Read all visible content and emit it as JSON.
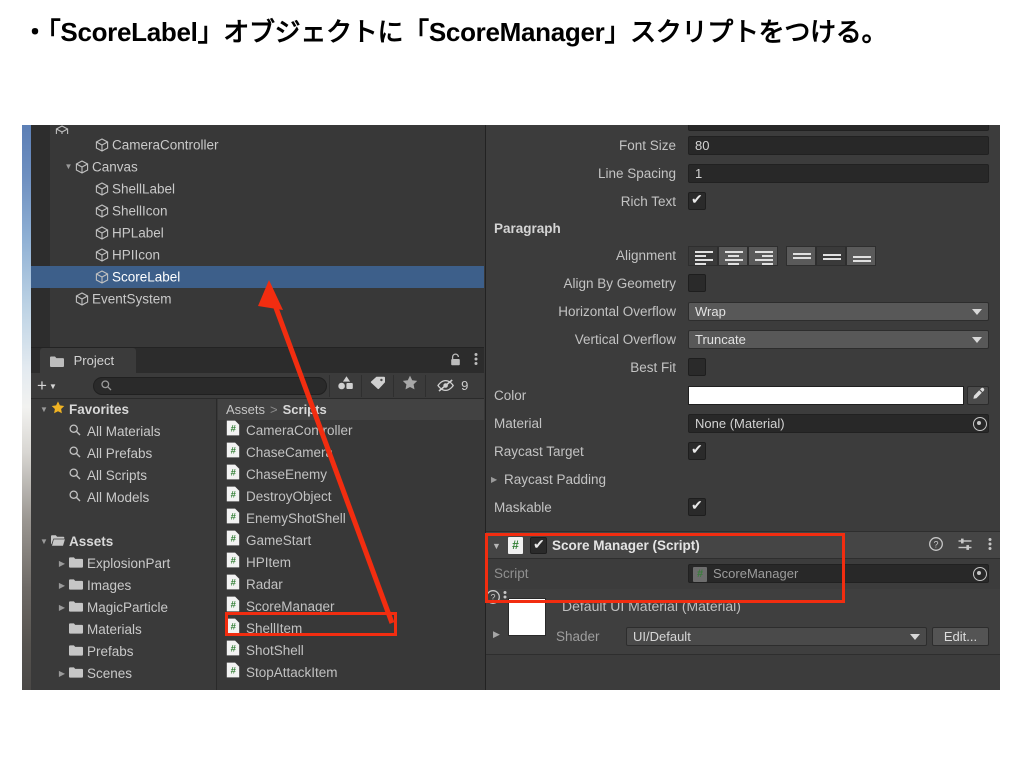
{
  "slide": {
    "heading": "・「ScoreLabel」オブジェクトに「ScoreManager」スクリプトをつける。"
  },
  "accent_color": "#f22d10",
  "selection_color": "#3d5f8a",
  "hierarchy": {
    "rows": [
      {
        "label": "",
        "indent": 0,
        "twisty": "",
        "icon": "cube-icon",
        "selected": false,
        "clipped": true
      },
      {
        "label": "CameraController",
        "indent": 2,
        "twisty": "",
        "icon": "cube-icon",
        "selected": false
      },
      {
        "label": "Canvas",
        "indent": 1,
        "twisty": "▼",
        "icon": "cube-icon",
        "selected": false
      },
      {
        "label": "ShellLabel",
        "indent": 2,
        "twisty": "",
        "icon": "cube-icon",
        "selected": false
      },
      {
        "label": "ShellIcon",
        "indent": 2,
        "twisty": "",
        "icon": "cube-icon",
        "selected": false
      },
      {
        "label": "HPLabel",
        "indent": 2,
        "twisty": "",
        "icon": "cube-icon",
        "selected": false
      },
      {
        "label": "HPIIcon",
        "indent": 2,
        "twisty": "",
        "icon": "cube-icon",
        "selected": false
      },
      {
        "label": "ScoreLabel",
        "indent": 2,
        "twisty": "",
        "icon": "cube-icon",
        "selected": true
      },
      {
        "label": "EventSystem",
        "indent": 1,
        "twisty": "",
        "icon": "cube-icon",
        "selected": false
      }
    ]
  },
  "project": {
    "tab_label": "Project",
    "tab_icon": "folder-icon",
    "lock_icon": "lock-icon",
    "menu_icon": "kebab-menu-icon",
    "add_label": "+",
    "search_placeholder": "",
    "search_value": "",
    "toolbar_icons": [
      {
        "name": "asset-type-filter-icon",
        "label": ""
      },
      {
        "name": "label-filter-icon",
        "label": ""
      },
      {
        "name": "favorite-star-icon",
        "label": ""
      },
      {
        "name": "hidden-packages-icon",
        "label": "9"
      }
    ],
    "tree": [
      {
        "label": "Favorites",
        "indent": 0,
        "twisty": "▼",
        "icon": "star-icon",
        "bold": true
      },
      {
        "label": "All Materials",
        "indent": 1,
        "twisty": "",
        "icon": "search-icon",
        "bold": false
      },
      {
        "label": "All Prefabs",
        "indent": 1,
        "twisty": "",
        "icon": "search-icon",
        "bold": false
      },
      {
        "label": "All Scripts",
        "indent": 1,
        "twisty": "",
        "icon": "search-icon",
        "bold": false
      },
      {
        "label": "All Models",
        "indent": 1,
        "twisty": "",
        "icon": "search-icon",
        "bold": false
      },
      {
        "label": "",
        "indent": 0,
        "twisty": "",
        "icon": "",
        "bold": false
      },
      {
        "label": "Assets",
        "indent": 0,
        "twisty": "▼",
        "icon": "folder-open-icon",
        "bold": true
      },
      {
        "label": "ExplosionPart",
        "indent": 1,
        "twisty": "▶",
        "icon": "folder-icon",
        "bold": false
      },
      {
        "label": "Images",
        "indent": 1,
        "twisty": "▶",
        "icon": "folder-icon",
        "bold": false
      },
      {
        "label": "MagicParticle",
        "indent": 1,
        "twisty": "▶",
        "icon": "folder-icon",
        "bold": false
      },
      {
        "label": "Materials",
        "indent": 1,
        "twisty": "",
        "icon": "folder-icon",
        "bold": false
      },
      {
        "label": "Prefabs",
        "indent": 1,
        "twisty": "",
        "icon": "folder-icon",
        "bold": false
      },
      {
        "label": "Scenes",
        "indent": 1,
        "twisty": "▶",
        "icon": "folder-icon",
        "bold": false
      }
    ],
    "breadcrumb": {
      "root": "Assets",
      "separator": ">",
      "current": "Scripts"
    },
    "assets": [
      {
        "label": "CameraController",
        "icon": "cs-script-icon",
        "highlighted": false
      },
      {
        "label": "ChaseCamera",
        "icon": "cs-script-icon",
        "highlighted": false
      },
      {
        "label": "ChaseEnemy",
        "icon": "cs-script-icon",
        "highlighted": false
      },
      {
        "label": "DestroyObject",
        "icon": "cs-script-icon",
        "highlighted": false
      },
      {
        "label": "EnemyShotShell",
        "icon": "cs-script-icon",
        "highlighted": false
      },
      {
        "label": "GameStart",
        "icon": "cs-script-icon",
        "highlighted": false
      },
      {
        "label": "HPItem",
        "icon": "cs-script-icon",
        "highlighted": false
      },
      {
        "label": "Radar",
        "icon": "cs-script-icon",
        "highlighted": false
      },
      {
        "label": "ScoreManager",
        "icon": "cs-script-icon",
        "highlighted": true
      },
      {
        "label": "ShellItem",
        "icon": "cs-script-icon",
        "highlighted": false
      },
      {
        "label": "ShotShell",
        "icon": "cs-script-icon",
        "highlighted": false
      },
      {
        "label": "StopAttackItem",
        "icon": "cs-script-icon",
        "highlighted": false
      }
    ]
  },
  "inspector": {
    "text_component": {
      "font_size": {
        "label": "Font Size",
        "value": "80"
      },
      "line_spacing": {
        "label": "Line Spacing",
        "value": "1"
      },
      "rich_text": {
        "label": "Rich Text",
        "checked": true
      },
      "paragraph_header": "Paragraph",
      "alignment": {
        "label": "Alignment",
        "horizontal_options": [
          "align-left",
          "align-center",
          "align-right"
        ],
        "horizontal_selected": 0,
        "vertical_options": [
          "align-top",
          "align-middle",
          "align-bottom"
        ],
        "vertical_selected": 1
      },
      "align_by_geometry": {
        "label": "Align By Geometry",
        "checked": false
      },
      "horizontal_overflow": {
        "label": "Horizontal Overflow",
        "value": "Wrap"
      },
      "vertical_overflow": {
        "label": "Vertical Overflow",
        "value": "Truncate"
      },
      "best_fit": {
        "label": "Best Fit",
        "checked": false
      },
      "color": {
        "label": "Color",
        "value": "#FFFFFF"
      },
      "material": {
        "label": "Material",
        "value": "None (Material)"
      },
      "raycast_target": {
        "label": "Raycast Target",
        "checked": true
      },
      "raycast_padding": {
        "label": "Raycast Padding"
      },
      "maskable": {
        "label": "Maskable",
        "checked": true
      }
    },
    "score_manager": {
      "title": "Score Manager (Script)",
      "enabled": true,
      "icon": "cs-script-icon",
      "help_icon": "help-icon",
      "preset_icon": "preset-icon",
      "menu_icon": "kebab-menu-icon",
      "script_field": {
        "label": "Script",
        "value": "ScoreManager"
      }
    },
    "material_preview": {
      "title": "Default UI Material (Material)",
      "help_icon": "help-icon",
      "menu_icon": "kebab-menu-icon",
      "shader_label": "Shader",
      "shader_value": "UI/Default",
      "edit_label": "Edit..."
    }
  }
}
